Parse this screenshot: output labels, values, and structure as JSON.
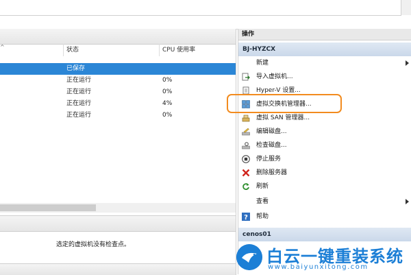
{
  "vm_table": {
    "columns": {
      "state": "状态",
      "cpu": "CPU 使用率"
    },
    "rows": [
      {
        "state": "已保存",
        "cpu": ""
      },
      {
        "state": "正在运行",
        "cpu": "0%"
      },
      {
        "state": "正在运行",
        "cpu": "0%"
      },
      {
        "state": "正在运行",
        "cpu": "4%"
      },
      {
        "state": "正在运行",
        "cpu": "0%"
      }
    ]
  },
  "checkpoint": {
    "message": "选定的虚拟机没有检查点。"
  },
  "actions": {
    "title": "操作",
    "server_group": "BJ-HYZCX",
    "items": [
      {
        "label": "新建",
        "icon": "blank-icon",
        "submenu": true
      },
      {
        "label": "导入虚拟机...",
        "icon": "import-icon"
      },
      {
        "label": "Hyper-V 设置...",
        "icon": "settings-page-icon"
      },
      {
        "label": "虚拟交换机管理器...",
        "icon": "switch-manager-icon"
      },
      {
        "label": "虚拟 SAN 管理器...",
        "icon": "san-manager-icon"
      },
      {
        "label": "编辑磁盘...",
        "icon": "edit-disk-icon"
      },
      {
        "label": "检查磁盘...",
        "icon": "inspect-disk-icon"
      },
      {
        "label": "停止服务",
        "icon": "stop-icon"
      },
      {
        "label": "删除服务器",
        "icon": "delete-icon"
      },
      {
        "label": "刷新",
        "icon": "refresh-icon"
      },
      {
        "label": "查看",
        "icon": "blank-icon",
        "submenu": true
      },
      {
        "label": "帮助",
        "icon": "help-icon"
      }
    ],
    "vm_group": "cenos01"
  },
  "watermark": {
    "title": "白云一键重装系统",
    "url": "www.baiyunxitong.com"
  },
  "colors": {
    "selection": "#2b86d6",
    "highlight": "#f28b1e",
    "brand": "#1c7fd6"
  }
}
